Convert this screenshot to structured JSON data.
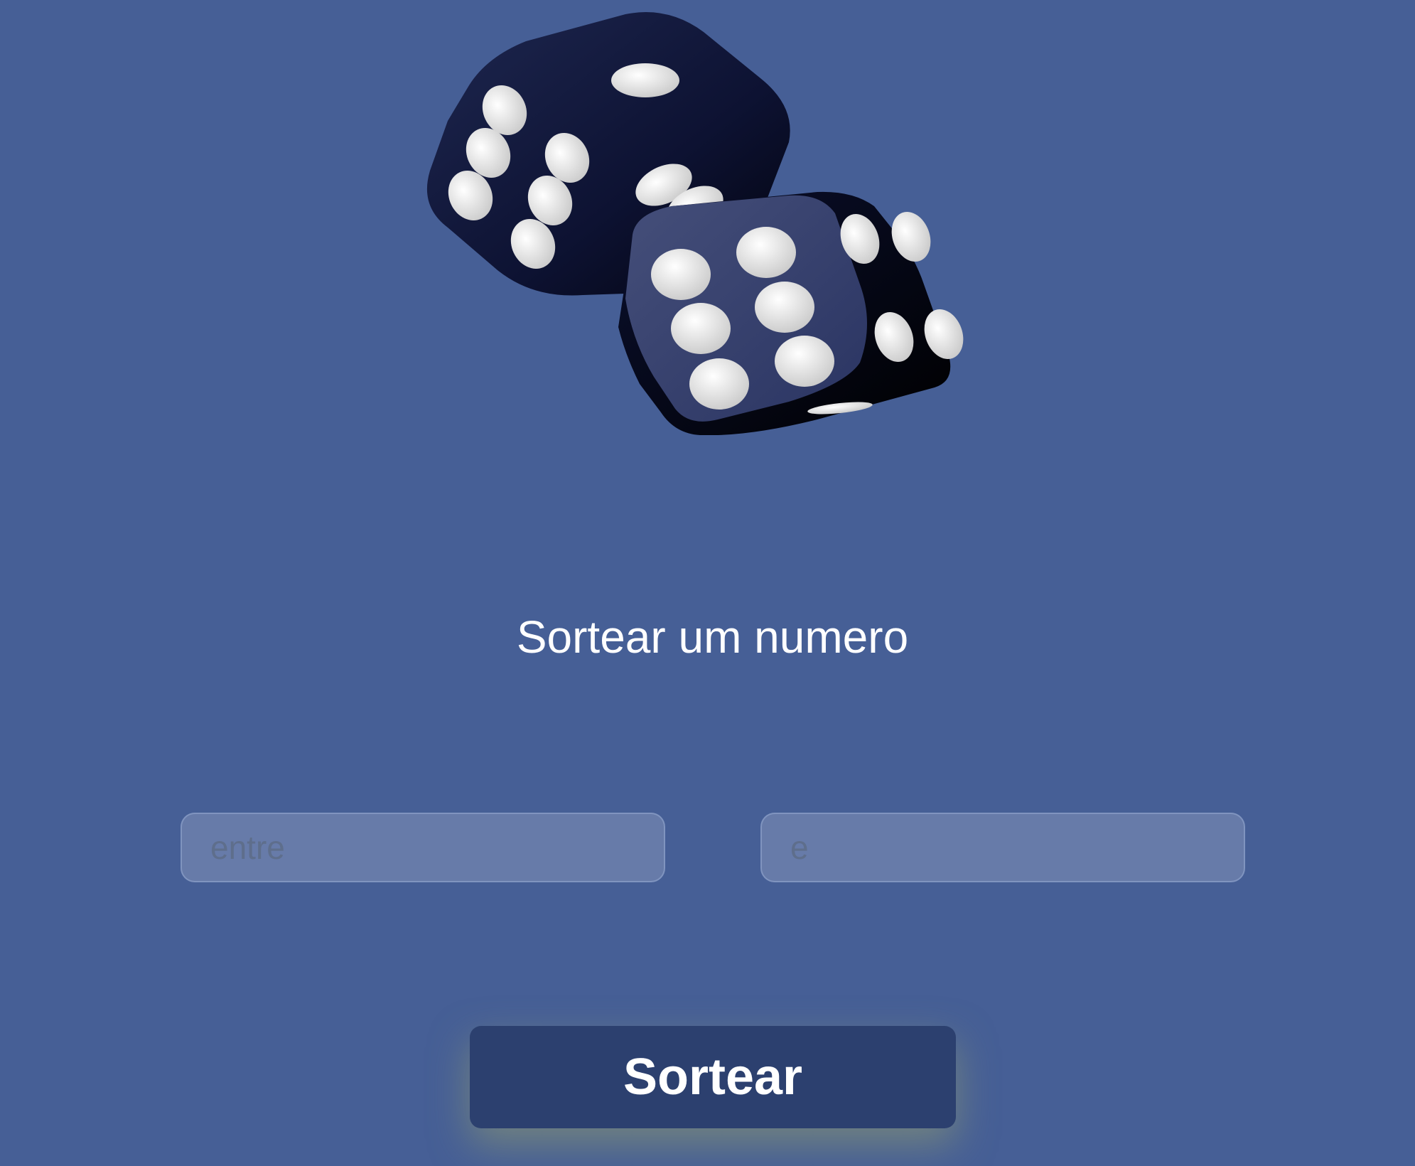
{
  "header": {
    "title": "Sortear um numero",
    "illustration": "dice-icon"
  },
  "form": {
    "min_placeholder": "entre",
    "max_placeholder": "e",
    "min_value": "",
    "max_value": ""
  },
  "actions": {
    "draw_label": "Sortear"
  },
  "colors": {
    "background": "#465f96",
    "button": "#2c406f",
    "dice": "#0b1030",
    "pips": "#e8e8e8",
    "text": "#ffffff"
  }
}
